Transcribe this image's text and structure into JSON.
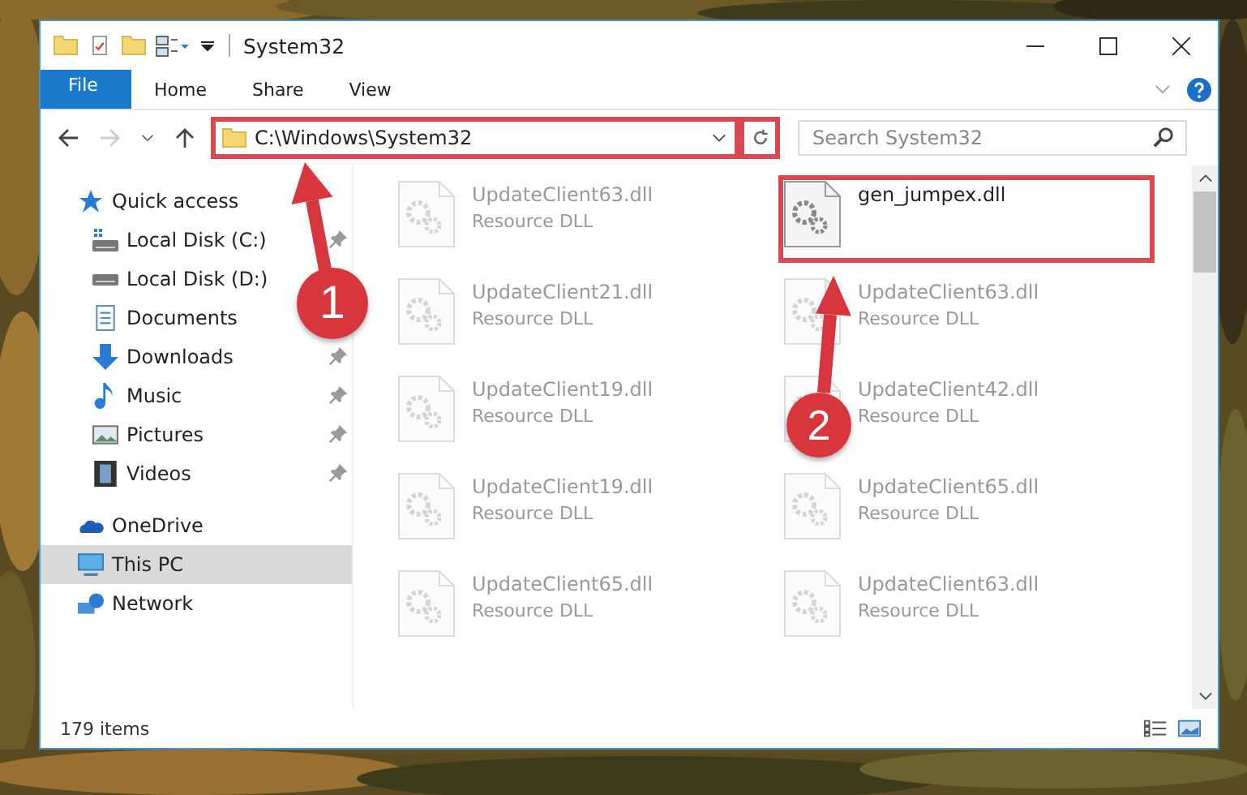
{
  "window": {
    "title": "System32"
  },
  "ribbon_tabs": [
    {
      "label": "File",
      "kind": "file"
    },
    {
      "label": "Home",
      "kind": "tab"
    },
    {
      "label": "Share",
      "kind": "tab"
    },
    {
      "label": "View",
      "kind": "tab"
    }
  ],
  "address": {
    "path": "C:\\Windows\\System32",
    "highlighted": true
  },
  "refresh": {
    "highlighted": true
  },
  "search": {
    "placeholder": "Search System32"
  },
  "sidebar": {
    "items": [
      {
        "label": "Quick access",
        "kind": "star",
        "selected": false,
        "children": [
          {
            "label": "Local Disk (C:)",
            "kind": "system-drive",
            "pinned": true
          },
          {
            "label": "Local Disk (D:)",
            "kind": "drive",
            "pinned": false
          },
          {
            "label": "Documents",
            "kind": "documents",
            "pinned": false
          },
          {
            "label": "Downloads",
            "kind": "downloads",
            "pinned": true
          },
          {
            "label": "Music",
            "kind": "music",
            "pinned": true
          },
          {
            "label": "Pictures",
            "kind": "pictures",
            "pinned": true
          },
          {
            "label": "Videos",
            "kind": "videos",
            "pinned": true
          }
        ]
      },
      {
        "label": "OneDrive",
        "kind": "cloud",
        "selected": false
      },
      {
        "label": "This PC",
        "kind": "pc",
        "selected": true
      },
      {
        "label": "Network",
        "kind": "network",
        "selected": false
      }
    ]
  },
  "files": [
    {
      "name": "UpdateClient63.dll",
      "type": "Resource DLL",
      "faded": true,
      "highlighted": false
    },
    {
      "name": "gen_jumpex.dll",
      "faded": false,
      "highlighted": true
    },
    {
      "name": "UpdateClient21.dll",
      "type": "Resource DLL",
      "faded": true,
      "highlighted": false
    },
    {
      "name": "UpdateClient63.dll",
      "type": "Resource DLL",
      "faded": true,
      "highlighted": false
    },
    {
      "name": "UpdateClient19.dll",
      "type": "Resource DLL",
      "faded": true,
      "highlighted": false
    },
    {
      "name": "UpdateClient42.dll",
      "type": "Resource DLL",
      "faded": true,
      "highlighted": false
    },
    {
      "name": "UpdateClient19.dll",
      "type": "Resource DLL",
      "faded": true,
      "highlighted": false
    },
    {
      "name": "UpdateClient65.dll",
      "type": "Resource DLL",
      "faded": true,
      "highlighted": false
    },
    {
      "name": "UpdateClient65.dll",
      "type": "Resource DLL",
      "faded": true,
      "highlighted": false
    },
    {
      "name": "UpdateClient63.dll",
      "type": "Resource DLL",
      "faded": true,
      "highlighted": false
    }
  ],
  "status_bar": {
    "item_count": "179 items"
  },
  "annotations": [
    {
      "number": "1"
    },
    {
      "number": "2"
    }
  ]
}
